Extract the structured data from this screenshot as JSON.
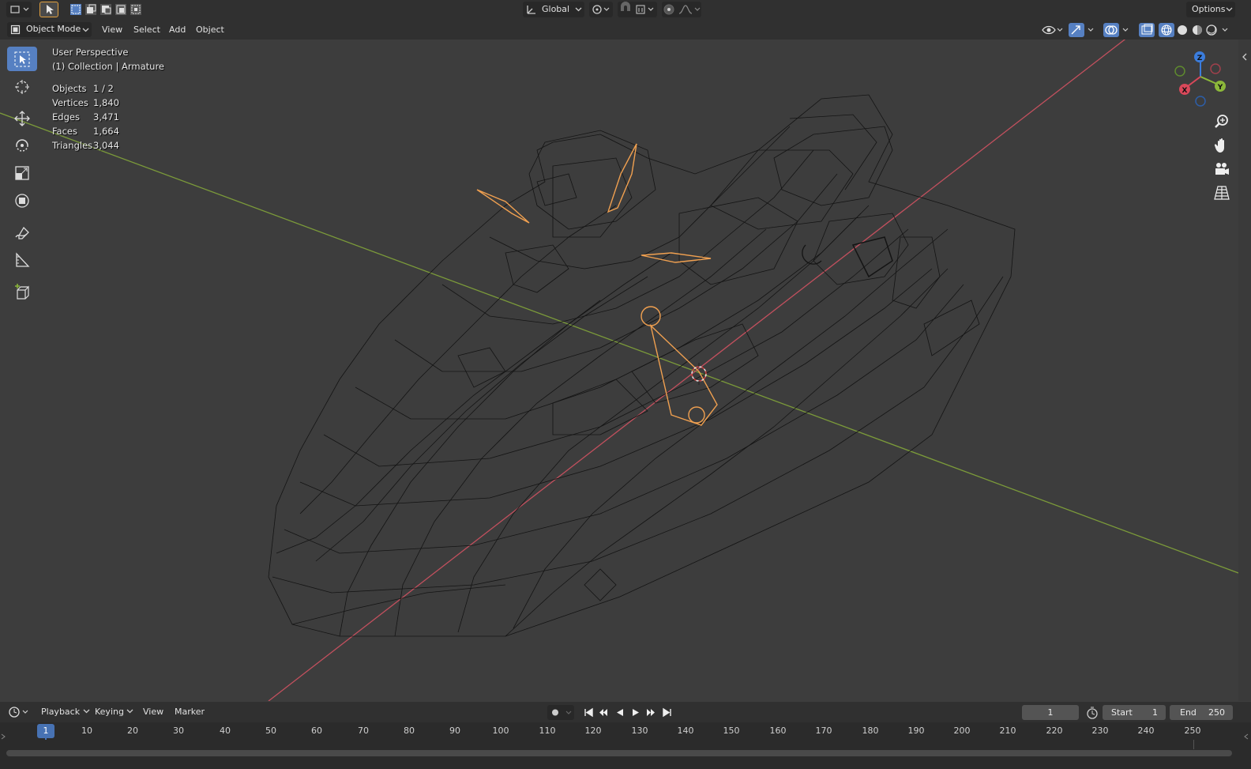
{
  "header": {
    "transform_orientation": "Global",
    "options_label": "Options"
  },
  "menubar": {
    "mode_label": "Object Mode",
    "menus": [
      "View",
      "Select",
      "Add",
      "Object"
    ]
  },
  "overlay": {
    "perspective": "User Perspective",
    "collection": "(1) Collection | Armature",
    "stats": [
      {
        "label": "Objects",
        "value": "1 / 2"
      },
      {
        "label": "Vertices",
        "value": "1,840"
      },
      {
        "label": "Edges",
        "value": "3,471"
      },
      {
        "label": "Faces",
        "value": "1,664"
      },
      {
        "label": "Triangles",
        "value": "3,044"
      }
    ]
  },
  "gizmo": {
    "x": "X",
    "y": "Y",
    "z": "Z"
  },
  "timeline": {
    "menus": [
      "Playback",
      "Keying",
      "View",
      "Marker"
    ],
    "current_frame": "1",
    "start_label": "Start",
    "start_value": "1",
    "end_label": "End",
    "end_value": "250",
    "ruler": [
      "1",
      "10",
      "20",
      "30",
      "40",
      "50",
      "60",
      "70",
      "80",
      "90",
      "100",
      "110",
      "120",
      "130",
      "140",
      "150",
      "160",
      "170",
      "180",
      "190",
      "200",
      "210",
      "220",
      "230",
      "240",
      "250"
    ]
  },
  "colors": {
    "x_axis": "#c2505e",
    "y_axis": "#7b9a3a",
    "bone": "#f0a050",
    "wire": "#111111",
    "accent": "#5680c2"
  }
}
